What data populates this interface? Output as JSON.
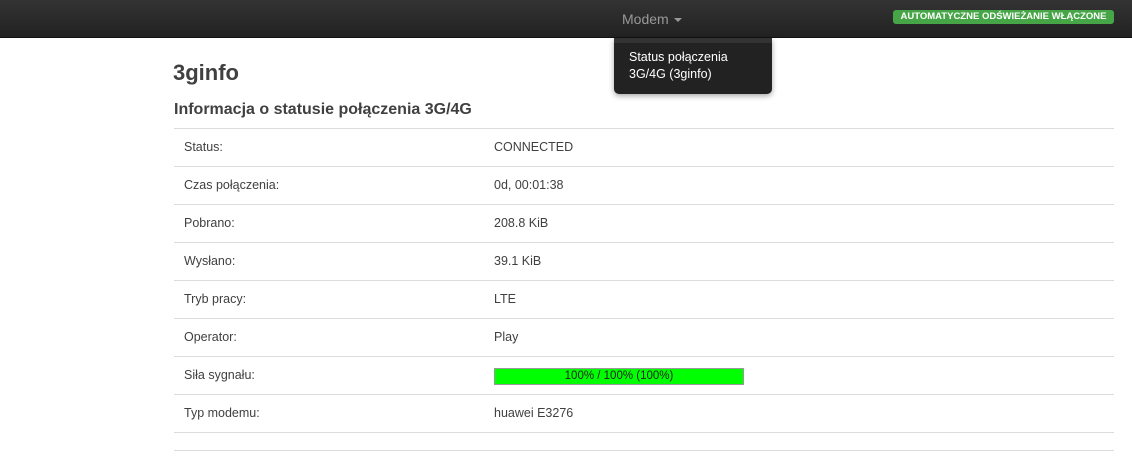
{
  "navbar": {
    "menu_label": "Modem",
    "refresh_badge": "AUTOMATYCZNE ODŚWIEŻANIE WŁĄCZONE",
    "dropdown_items": [
      "Status połączenia 3G/4G (3ginfo)"
    ]
  },
  "page": {
    "title": "3ginfo",
    "section_title": "Informacja o statusie połączenia 3G/4G"
  },
  "rows": [
    {
      "label": "Status:",
      "value": "CONNECTED"
    },
    {
      "label": "Czas połączenia:",
      "value": "0d, 00:01:38"
    },
    {
      "label": "Pobrano:",
      "value": "208.8 KiB"
    },
    {
      "label": "Wysłano:",
      "value": "39.1 KiB"
    },
    {
      "label": "Tryb pracy:",
      "value": "LTE"
    },
    {
      "label": "Operator:",
      "value": "Play"
    },
    {
      "label": "Siła sygnału:",
      "value": "100% / 100% (100%)",
      "percent": 100
    },
    {
      "label": "Typ modemu:",
      "value": "huawei E3276"
    }
  ],
  "colors": {
    "signal_fill": "#00ff00",
    "badge": "#46a546",
    "navbar": "#222222"
  }
}
